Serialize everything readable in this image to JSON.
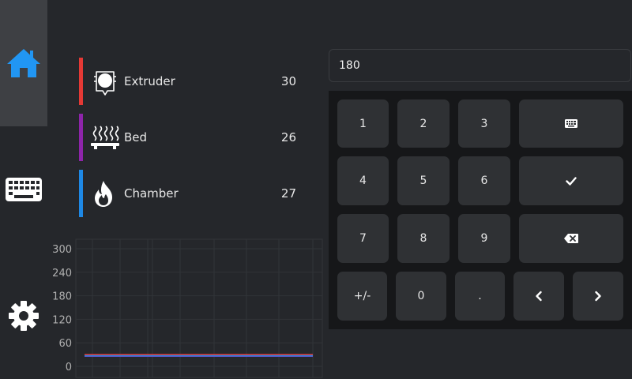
{
  "sidebar": {
    "items": [
      {
        "icon": "home-icon",
        "active": true
      },
      {
        "icon": "keyboard-icon",
        "active": false
      },
      {
        "icon": "gear-icon",
        "active": false
      }
    ],
    "accent": "#2196f3"
  },
  "heaters": [
    {
      "name": "Extruder",
      "temp": "30",
      "color": "#e53935",
      "icon": "extruder-icon"
    },
    {
      "name": "Bed",
      "temp": "26",
      "color": "#8e24aa",
      "icon": "bed-icon"
    },
    {
      "name": "Chamber",
      "temp": "27",
      "color": "#1e88e5",
      "icon": "flame-icon"
    }
  ],
  "input": {
    "value": "180"
  },
  "keypad": {
    "keys": {
      "k1": "1",
      "k2": "2",
      "k3": "3",
      "k4": "4",
      "k5": "5",
      "k6": "6",
      "k7": "7",
      "k8": "8",
      "k9": "9",
      "sign": "+/-",
      "k0": "0",
      "dot": "."
    }
  },
  "chart_data": {
    "type": "line",
    "title": "",
    "xlabel": "",
    "ylabel": "",
    "ylim": [
      0,
      300
    ],
    "yticks": [
      "300",
      "240",
      "180",
      "120",
      "60",
      "0"
    ],
    "grid": true,
    "series": [
      {
        "color": "#e53935",
        "values": [
          30,
          30,
          30,
          30,
          30,
          30,
          30,
          30,
          30,
          30
        ]
      },
      {
        "color": "#8e24aa",
        "values": [
          26,
          26,
          26,
          26,
          26,
          26,
          26,
          26,
          26,
          26
        ]
      },
      {
        "color": "#1e88e5",
        "values": [
          27,
          27,
          27,
          27,
          27,
          27,
          27,
          27,
          27,
          27
        ]
      }
    ]
  }
}
